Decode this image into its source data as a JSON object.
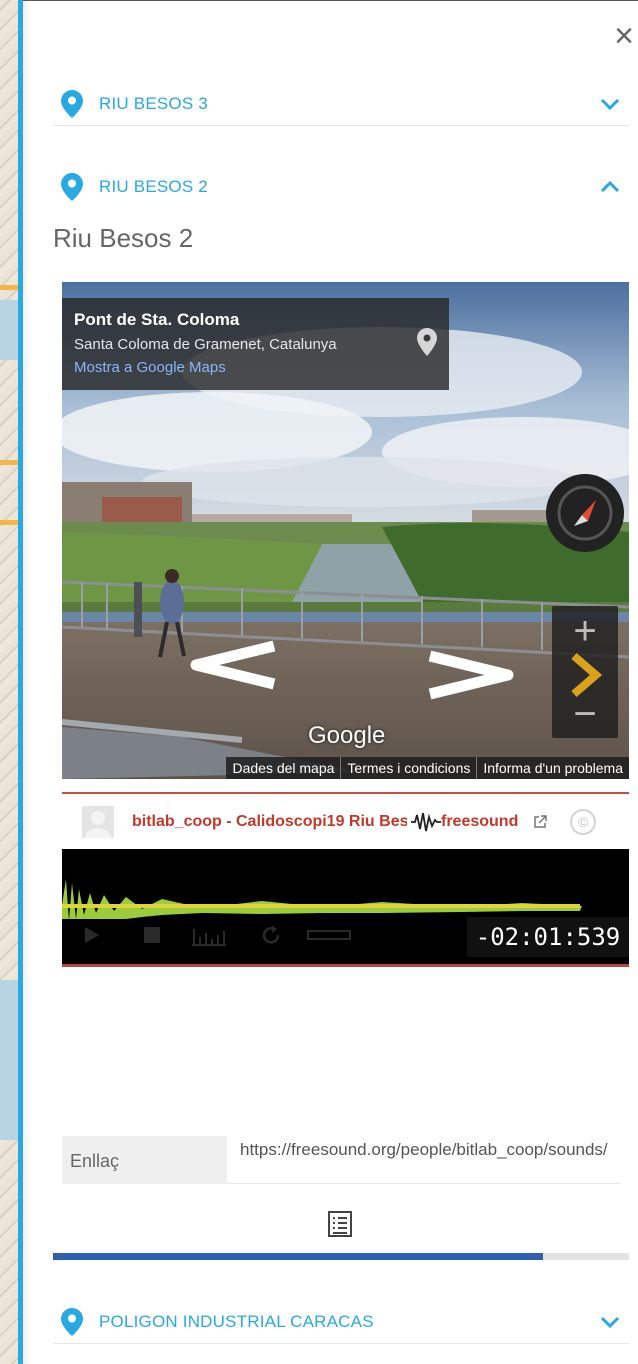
{
  "close_label": "×",
  "sections": [
    {
      "title": "RIU BESOS 3",
      "expanded": false
    },
    {
      "title": "RIU BESOS 2",
      "expanded": true
    },
    {
      "title": "POLIGON INDUSTRIAL CARACAS",
      "expanded": false
    }
  ],
  "place": {
    "title": "Riu Besos 2",
    "streetview": {
      "location_name": "Pont de Sta. Coloma",
      "location_sub": "Santa Coloma de Gramenet, Catalunya",
      "maps_link": "Mostra a Google Maps",
      "logo_text": "Google",
      "footer": [
        "Dades del mapa",
        "Termes i condicions",
        "Informa d'un problema"
      ],
      "zoom_in": "+",
      "zoom_out": "−"
    },
    "freesound": {
      "title": "bitlab_coop - Calidoscopi19 Riu Besos",
      "brand": "freesound",
      "license_icon": "cc-icon",
      "time": "-02:01:539",
      "progress": 0.0
    },
    "link": {
      "label": "Enllaç",
      "value": "https://freesound.org/people/bitlab_coop/sounds/"
    }
  },
  "scroll_progress": 0.85,
  "colors": {
    "accent": "#29a9e1",
    "freesound_red": "#c0392b",
    "progress": "#2f5fb0"
  }
}
